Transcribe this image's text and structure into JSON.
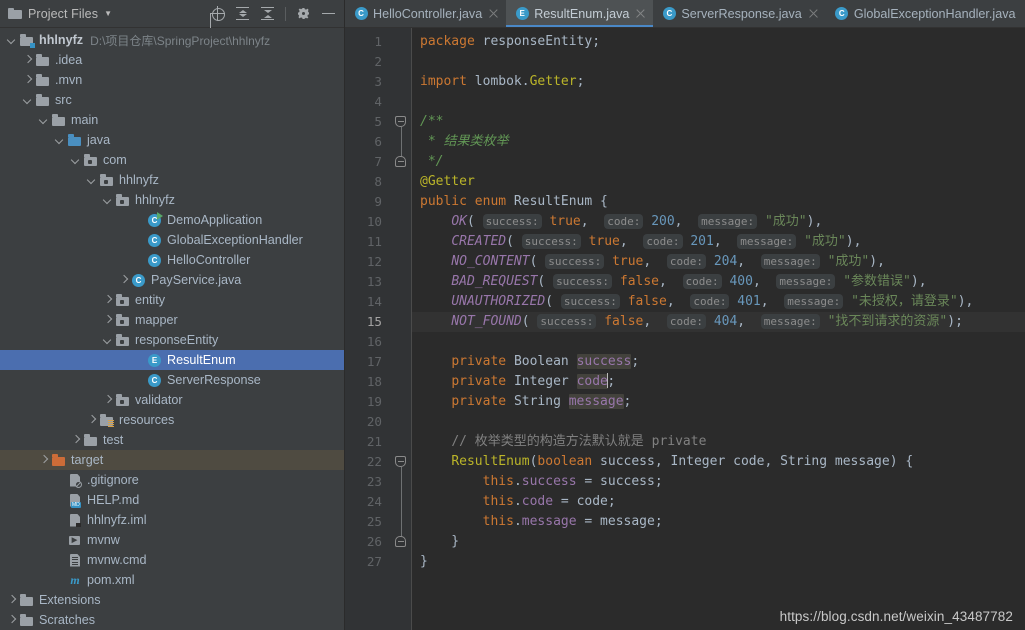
{
  "panel": {
    "title": "Project Files",
    "caret_icon": "chevron-down-icon",
    "toolbar": [
      {
        "name": "locate-in-tree-icon",
        "label": "Select Opened File"
      },
      {
        "name": "expand-all-icon",
        "label": "Expand All"
      },
      {
        "name": "collapse-all-icon",
        "label": "Collapse All"
      },
      {
        "name": "settings-gear-icon",
        "label": "Settings"
      },
      {
        "name": "minimize-icon",
        "label": "Hide"
      }
    ]
  },
  "tree": [
    {
      "label": "hhlnyfz",
      "hint": "D:\\项目仓库\\SpringProject\\hhlnyfz",
      "indent": 0,
      "arrow": "down",
      "icon": "module-folder",
      "bold": true,
      "state": "normal"
    },
    {
      "label": ".idea",
      "hint": "",
      "indent": 1,
      "arrow": "right",
      "icon": "folder",
      "bold": false,
      "state": "normal"
    },
    {
      "label": ".mvn",
      "hint": "",
      "indent": 1,
      "arrow": "right",
      "icon": "folder",
      "bold": false,
      "state": "normal"
    },
    {
      "label": "src",
      "hint": "",
      "indent": 1,
      "arrow": "down",
      "icon": "folder",
      "bold": false,
      "state": "normal"
    },
    {
      "label": "main",
      "hint": "",
      "indent": 2,
      "arrow": "down",
      "icon": "folder",
      "bold": false,
      "state": "normal"
    },
    {
      "label": "java",
      "hint": "",
      "indent": 3,
      "arrow": "down",
      "icon": "source-folder",
      "bold": false,
      "state": "normal"
    },
    {
      "label": "com",
      "hint": "",
      "indent": 4,
      "arrow": "down",
      "icon": "package-folder",
      "bold": false,
      "state": "normal"
    },
    {
      "label": "hhlnyfz",
      "hint": "",
      "indent": 5,
      "arrow": "down",
      "icon": "package-folder",
      "bold": false,
      "state": "normal"
    },
    {
      "label": "hhlnyfz",
      "hint": "",
      "indent": 6,
      "arrow": "down",
      "icon": "package-folder",
      "bold": false,
      "state": "normal"
    },
    {
      "label": "DemoApplication",
      "hint": "",
      "indent": 8,
      "arrow": "none",
      "icon": "class-runnable",
      "bold": false,
      "state": "normal"
    },
    {
      "label": "GlobalExceptionHandler",
      "hint": "",
      "indent": 8,
      "arrow": "none",
      "icon": "class",
      "bold": false,
      "state": "normal"
    },
    {
      "label": "HelloController",
      "hint": "",
      "indent": 8,
      "arrow": "none",
      "icon": "class",
      "bold": false,
      "state": "normal"
    },
    {
      "label": "PayService.java",
      "hint": "",
      "indent": 7,
      "arrow": "right",
      "icon": "class",
      "bold": false,
      "state": "normal"
    },
    {
      "label": "entity",
      "hint": "",
      "indent": 6,
      "arrow": "right",
      "icon": "package-folder",
      "bold": false,
      "state": "normal"
    },
    {
      "label": "mapper",
      "hint": "",
      "indent": 6,
      "arrow": "right",
      "icon": "package-folder",
      "bold": false,
      "state": "normal"
    },
    {
      "label": "responseEntity",
      "hint": "",
      "indent": 6,
      "arrow": "down",
      "icon": "package-folder",
      "bold": false,
      "state": "normal"
    },
    {
      "label": "ResultEnum",
      "hint": "",
      "indent": 8,
      "arrow": "none",
      "icon": "enum",
      "bold": false,
      "state": "selected"
    },
    {
      "label": "ServerResponse",
      "hint": "",
      "indent": 8,
      "arrow": "none",
      "icon": "class",
      "bold": false,
      "state": "normal"
    },
    {
      "label": "validator",
      "hint": "",
      "indent": 6,
      "arrow": "right",
      "icon": "package-folder",
      "bold": false,
      "state": "normal"
    },
    {
      "label": "resources",
      "hint": "",
      "indent": 5,
      "arrow": "right",
      "icon": "resources-folder",
      "bold": false,
      "state": "normal"
    },
    {
      "label": "test",
      "hint": "",
      "indent": 4,
      "arrow": "right",
      "icon": "folder",
      "bold": false,
      "state": "normal"
    },
    {
      "label": "target",
      "hint": "",
      "indent": 2,
      "arrow": "right",
      "icon": "excluded-folder",
      "bold": false,
      "state": "highlighted"
    },
    {
      "label": ".gitignore",
      "hint": "",
      "indent": 3,
      "arrow": "none",
      "icon": "gitignore-file",
      "bold": false,
      "state": "normal"
    },
    {
      "label": "HELP.md",
      "hint": "",
      "indent": 3,
      "arrow": "none",
      "icon": "markdown-file",
      "bold": false,
      "state": "normal"
    },
    {
      "label": "hhlnyfz.iml",
      "hint": "",
      "indent": 3,
      "arrow": "none",
      "icon": "iml-file",
      "bold": false,
      "state": "normal"
    },
    {
      "label": "mvnw",
      "hint": "",
      "indent": 3,
      "arrow": "none",
      "icon": "shell-file",
      "bold": false,
      "state": "normal"
    },
    {
      "label": "mvnw.cmd",
      "hint": "",
      "indent": 3,
      "arrow": "none",
      "icon": "cmd-file",
      "bold": false,
      "state": "normal"
    },
    {
      "label": "pom.xml",
      "hint": "",
      "indent": 3,
      "arrow": "none",
      "icon": "maven-file",
      "bold": false,
      "state": "normal"
    },
    {
      "label": "Extensions",
      "hint": "",
      "indent": 0,
      "arrow": "right",
      "icon": "folder",
      "bold": false,
      "state": "normal"
    },
    {
      "label": "Scratches",
      "hint": "",
      "indent": 0,
      "arrow": "right",
      "icon": "folder",
      "bold": false,
      "state": "normal"
    }
  ],
  "tabs": [
    {
      "label": "HelloController.java",
      "icon": "class",
      "letter": "C",
      "active": false,
      "closable": true
    },
    {
      "label": "ResultEnum.java",
      "icon": "enum",
      "letter": "E",
      "active": true,
      "closable": true
    },
    {
      "label": "ServerResponse.java",
      "icon": "class",
      "letter": "C",
      "active": false,
      "closable": true
    },
    {
      "label": "GlobalExceptionHandler.java",
      "icon": "class",
      "letter": "C",
      "active": false,
      "closable": false
    }
  ],
  "editor": {
    "current_line": 15,
    "line_numbers": [
      1,
      2,
      3,
      4,
      5,
      6,
      7,
      8,
      9,
      10,
      11,
      12,
      13,
      14,
      15,
      16,
      17,
      18,
      19,
      20,
      21,
      22,
      23,
      24,
      25,
      26,
      27
    ],
    "source_lines": [
      "package responseEntity;",
      "",
      "import lombok.Getter;",
      "",
      "/**",
      " * 结果类枚举",
      " */",
      "@Getter",
      "public enum ResultEnum {",
      "    OK( success: true,  code: 200,  message: \"成功\"),",
      "    CREATED( success: true,  code: 201,  message: \"成功\"),",
      "    NO_CONTENT( success: true,  code: 204,  message: \"成功\"),",
      "    BAD_REQUEST( success: false,  code: 400,  message: \"参数错误\"),",
      "    UNAUTHORIZED( success: false,  code: 401,  message: \"未授权，请登录\"),",
      "    NOT_FOUND( success: false,  code: 404,  message: \"找不到请求的资源\");",
      "",
      "    private Boolean success;",
      "    private Integer code;",
      "    private String message;",
      "",
      "    // 枚举类型的构造方法默认就是 private",
      "    ResultEnum(boolean success, Integer code, String message) {",
      "        this.success = success;",
      "        this.code = code;",
      "        this.message = message;",
      "    }",
      "}"
    ],
    "enum_constants": [
      {
        "name": "OK",
        "success": "true",
        "code": "200",
        "message": "成功"
      },
      {
        "name": "CREATED",
        "success": "true",
        "code": "201",
        "message": "成功"
      },
      {
        "name": "NO_CONTENT",
        "success": "true",
        "code": "204",
        "message": "成功"
      },
      {
        "name": "BAD_REQUEST",
        "success": "false",
        "code": "400",
        "message": "参数错误"
      },
      {
        "name": "UNAUTHORIZED",
        "success": "false",
        "code": "401",
        "message": "未授权，请登录"
      },
      {
        "name": "NOT_FOUND",
        "success": "false",
        "code": "404",
        "message": "找不到请求的资源"
      }
    ],
    "parameter_hints": [
      "success:",
      "code:",
      "message:"
    ],
    "watermark": "https://blog.csdn.net/weixin_43487782"
  },
  "colors": {
    "panel_bg": "#3c3f41",
    "editor_bg": "#2b2b2b",
    "gutter_bg": "#313335",
    "selection_blue": "#4b6eaf",
    "excluded_highlight": "#4f4b41",
    "active_tab_bg": "#4e5254",
    "tab_underline": "#4a88c7",
    "keyword": "#cc7832",
    "string": "#6a8759",
    "number": "#6897bb",
    "comment": "#629755",
    "line_comment": "#808080",
    "annotation": "#bbb529",
    "field": "#9876aa",
    "default_text": "#a9b7c6",
    "usage_highlight": "#43423c"
  }
}
